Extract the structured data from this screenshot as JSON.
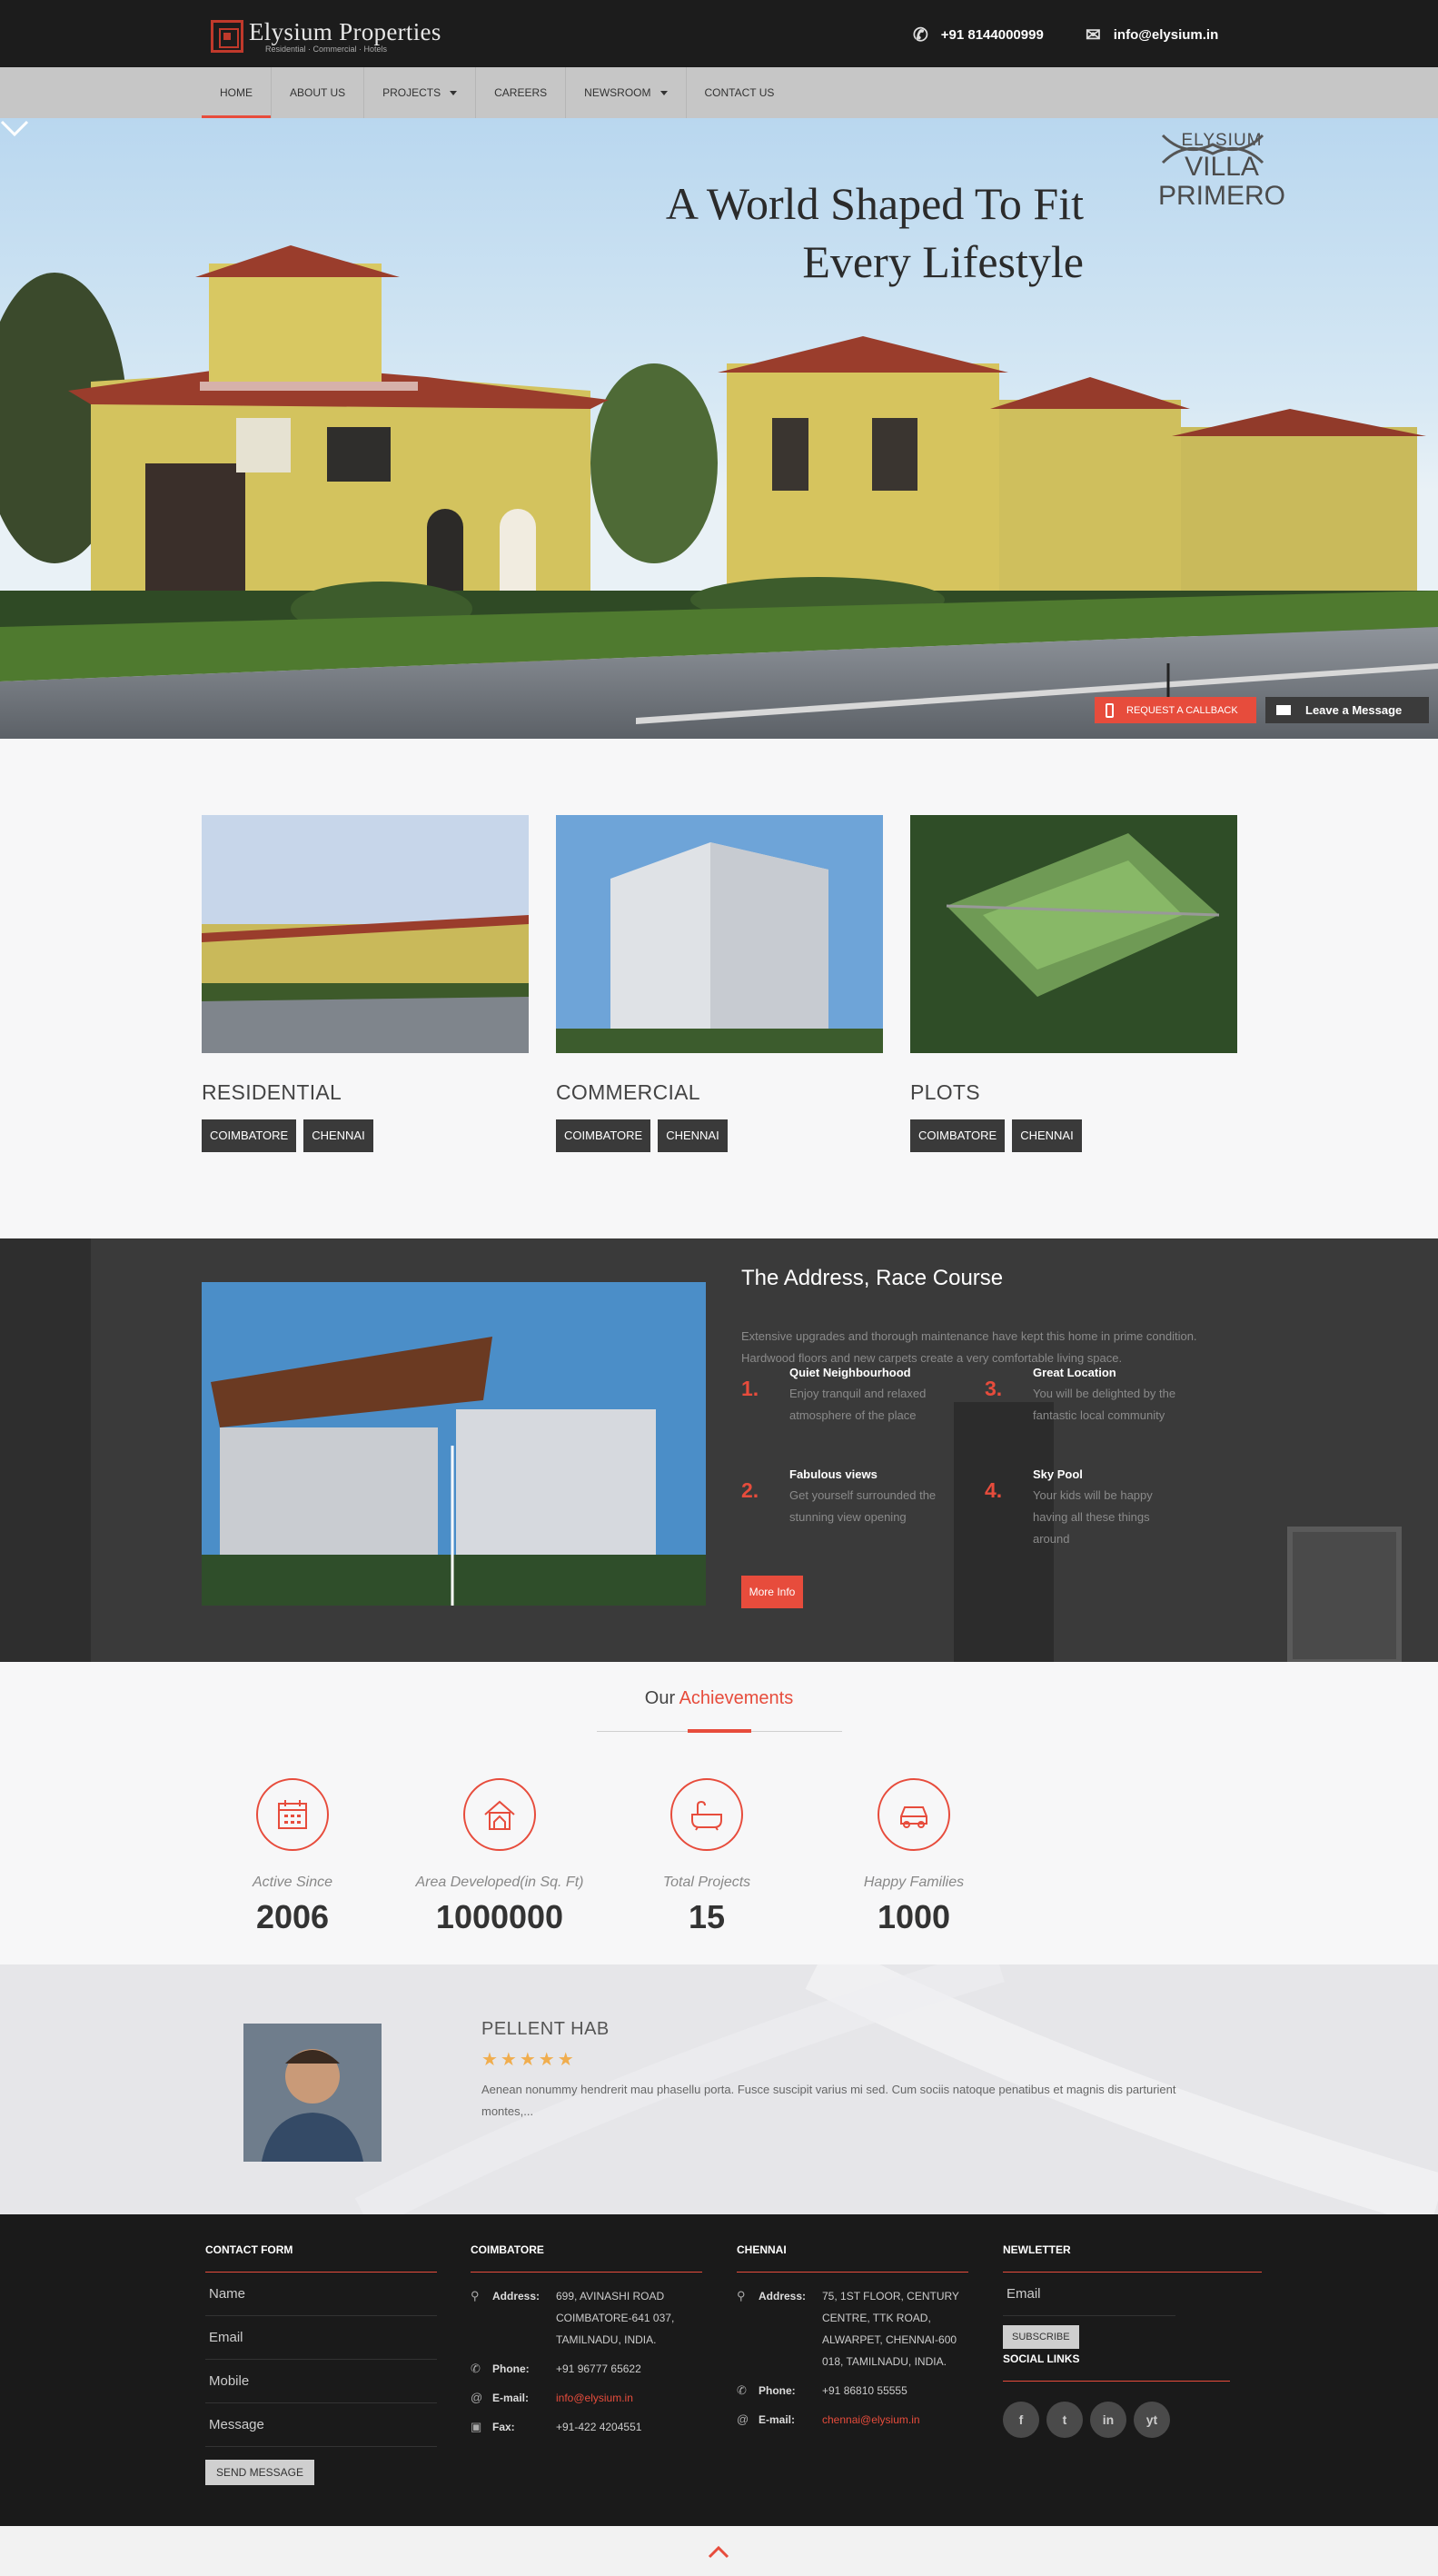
{
  "brand": {
    "name": "Elysium Properties",
    "tagline": "Residential · Commercial · Hotels"
  },
  "contact": {
    "phone": "+91 8144000999",
    "email": "info@elysium.in"
  },
  "nav": [
    "HOME",
    "ABOUT US",
    "PROJECTS",
    "CAREERS",
    "NEWSROOM",
    "CONTACT US"
  ],
  "hero": {
    "title_line1": "A World Shaped To Fit",
    "title_line2": "Every Lifestyle",
    "brand_top": "ELYSIUM",
    "brand_name_1": "VILLA",
    "brand_name_2": "PRIMERO",
    "callback_label": "REQUEST A CALLBACK",
    "message_label": "Leave a Message"
  },
  "categories": [
    {
      "title": "RESIDENTIAL",
      "tags": [
        "COIMBATORE",
        "CHENNAI"
      ]
    },
    {
      "title": "COMMERCIAL",
      "tags": [
        "COIMBATORE",
        "CHENNAI"
      ]
    },
    {
      "title": "PLOTS",
      "tags": [
        "COIMBATORE",
        "CHENNAI"
      ]
    }
  ],
  "feature": {
    "title": "The Address, Race Course",
    "desc": "Extensive upgrades and thorough maintenance have kept this home in prime condition. Hardwood floors and new carpets create a very comfortable living space.",
    "items": [
      {
        "num": "1.",
        "title": "Quiet Neighbourhood",
        "desc": "Enjoy tranquil and relaxed atmosphere of the place"
      },
      {
        "num": "2.",
        "title": "Fabulous views",
        "desc": "Get yourself surrounded the stunning view opening"
      },
      {
        "num": "3.",
        "title": "Great Location",
        "desc": "You will be delighted by the fantastic local community"
      },
      {
        "num": "4.",
        "title": "Sky Pool",
        "desc": "Your kids will be happy having all these things around"
      }
    ],
    "button": "More Info"
  },
  "achievements": {
    "title_a": "Our",
    "title_b": "Achievements",
    "stats": [
      {
        "label": "Active Since",
        "value": "2006",
        "icon": "calendar-icon"
      },
      {
        "label": "Area Developed(in Sq. Ft)",
        "value": "1000000",
        "icon": "house-icon"
      },
      {
        "label": "Total Projects",
        "value": "15",
        "icon": "bathtub-icon"
      },
      {
        "label": "Happy Families",
        "value": "1000",
        "icon": "car-icon"
      }
    ]
  },
  "testimonial": {
    "name": "PELLENT HAB",
    "stars": "★★★★★",
    "rating": 5,
    "text": "Aenean nonummy hendrerit mau phasellu porta. Fusce suscipit varius mi sed. Cum sociis natoque penatibus et magnis dis parturient montes,..."
  },
  "footer": {
    "contact_form": {
      "heading": "CONTACT FORM",
      "fields": [
        "Name",
        "Email",
        "Mobile",
        "Message"
      ],
      "button": "SEND MESSAGE"
    },
    "coimbatore": {
      "heading": "COIMBATORE",
      "address_label": "Address:",
      "address": "699, AVINASHI ROAD COIMBATORE-641 037, TAMILNADU, INDIA.",
      "phone_label": "Phone:",
      "phone": "+91 96777 65622",
      "email_label": "E-mail:",
      "email": "info@elysium.in",
      "fax_label": "Fax:",
      "fax": "+91-422 4204551"
    },
    "chennai": {
      "heading": "CHENNAI",
      "address_label": "Address:",
      "address": "75, 1ST FLOOR, CENTURY CENTRE, TTK ROAD, ALWARPET, CHENNAI-600 018, TAMILNADU, INDIA.",
      "phone_label": "Phone:",
      "phone": "+91 86810 55555",
      "email_label": "E-mail:",
      "email": "chennai@elysium.in"
    },
    "newsletter": {
      "heading": "NEWLETTER",
      "placeholder": "Email",
      "button": "SUBSCRIBE",
      "social_heading": "SOCIAL LINKS",
      "social": [
        "f",
        "t",
        "in",
        "yt"
      ]
    }
  },
  "colors": {
    "accent": "#e74c3c",
    "dark": "#1c1c1c",
    "nav": "#c6c6c6"
  }
}
